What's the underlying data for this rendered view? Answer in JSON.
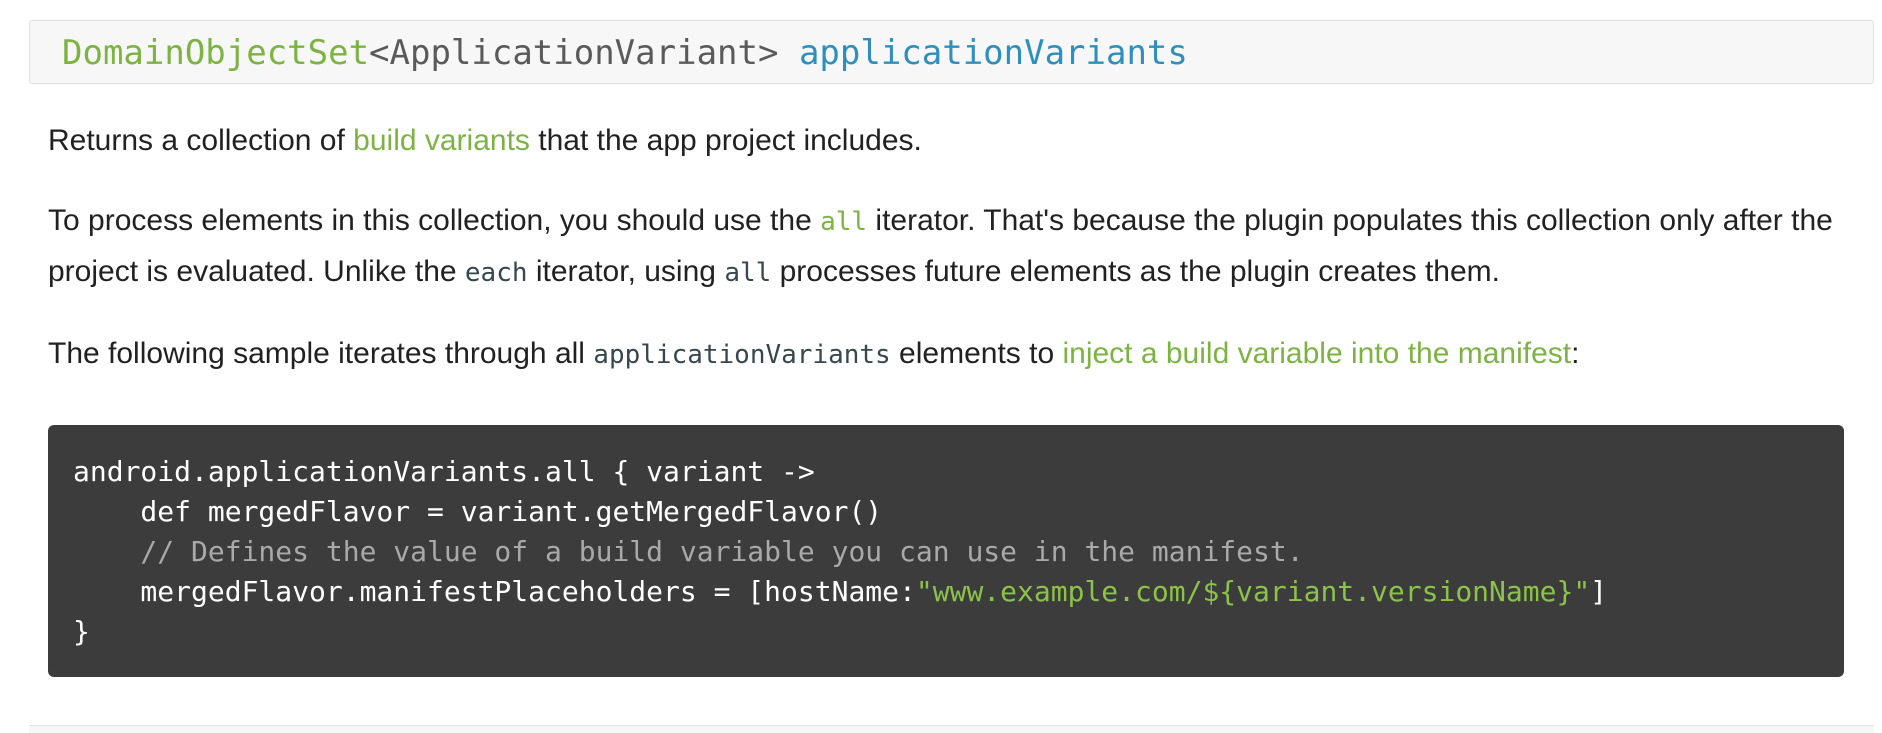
{
  "signature": {
    "type": "DomainObjectSet",
    "generic": "<ApplicationVariant>",
    "name": "applicationVariants"
  },
  "para1": {
    "before": "Returns a collection of ",
    "link": "build variants",
    "after": " that the app project includes."
  },
  "para2": {
    "t1": "To process elements in this collection, you should use the ",
    "code_all": "all",
    "t2": " iterator. That's because the plugin populates this collection only after the project is evaluated. Unlike the ",
    "code_each": "each",
    "t3": " iterator, using ",
    "code_all2": "all",
    "t4": " processes future elements as the plugin creates them."
  },
  "para3": {
    "t1": "The following sample iterates through all ",
    "code": "applicationVariants",
    "t2": " elements to ",
    "link": "inject a build variable into the manifest",
    "t3": ":"
  },
  "code": {
    "line1": "android.applicationVariants.all { variant ->",
    "line2": "    def mergedFlavor = variant.getMergedFlavor()",
    "line3_comment": "    // Defines the value of a build variable you can use in the manifest.",
    "line4_prefix": "    mergedFlavor.manifestPlaceholders = [hostName:",
    "line4_string": "\"www.example.com/${variant.versionName}\"",
    "line4_suffix": "]",
    "line5": "}"
  },
  "colors": {
    "link": "#7cb342",
    "type": "#7cb342",
    "property_name": "#2e8fbe",
    "code_background": "#3c3c3c",
    "code_string": "#8bc34a",
    "code_comment": "#a9a9a9"
  }
}
